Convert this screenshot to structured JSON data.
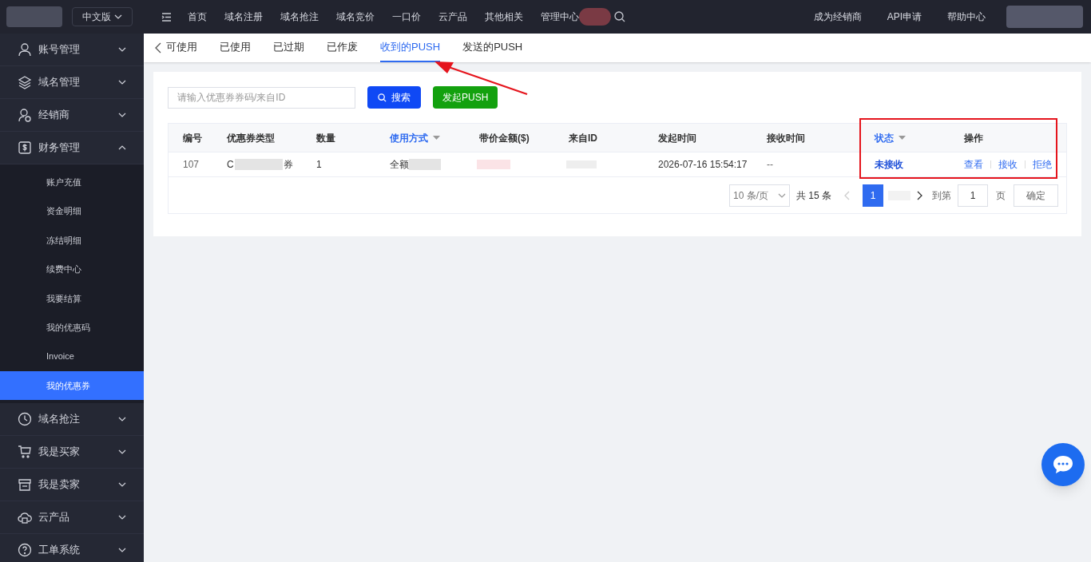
{
  "header": {
    "language": "中文版",
    "nav": [
      "首页",
      "域名注册",
      "域名抢注",
      "域名竞价",
      "一口价",
      "云产品",
      "其他相关",
      "管理中心"
    ],
    "right_links": [
      "成为经销商",
      "API申请",
      "帮助中心"
    ]
  },
  "sidebar": {
    "items": [
      {
        "label": "账号管理",
        "expanded": false
      },
      {
        "label": "域名管理",
        "expanded": false
      },
      {
        "label": "经销商",
        "expanded": false
      },
      {
        "label": "财务管理",
        "expanded": true,
        "children": [
          {
            "label": "账户充值",
            "selected": false
          },
          {
            "label": "资金明细",
            "selected": false
          },
          {
            "label": "冻结明细",
            "selected": false
          },
          {
            "label": "续费中心",
            "selected": false
          },
          {
            "label": "我要结算",
            "selected": false
          },
          {
            "label": "我的优惠码",
            "selected": false
          },
          {
            "label": "Invoice",
            "selected": false
          },
          {
            "label": "我的优惠券",
            "selected": true
          }
        ]
      },
      {
        "label": "域名抢注",
        "expanded": false
      },
      {
        "label": "我是买家",
        "expanded": false
      },
      {
        "label": "我是卖家",
        "expanded": false
      },
      {
        "label": "云产品",
        "expanded": false
      },
      {
        "label": "工单系统",
        "expanded": false
      }
    ]
  },
  "tabs": [
    {
      "label": "可使用",
      "selected": false
    },
    {
      "label": "已使用",
      "selected": false
    },
    {
      "label": "已过期",
      "selected": false
    },
    {
      "label": "已作废",
      "selected": false
    },
    {
      "label": "收到的PUSH",
      "selected": true
    },
    {
      "label": "发送的PUSH",
      "selected": false
    }
  ],
  "search": {
    "placeholder": "请输入优惠券券码/来自ID",
    "button": "搜索",
    "push_button": "发起PUSH"
  },
  "table": {
    "columns": [
      {
        "label": "编号",
        "sortable": false
      },
      {
        "label": "优惠券类型",
        "sortable": false
      },
      {
        "label": "数量",
        "sortable": false
      },
      {
        "label": "使用方式",
        "sortable": true
      },
      {
        "label": "带价金额($)",
        "sortable": false
      },
      {
        "label": "来自ID",
        "sortable": false
      },
      {
        "label": "发起时间",
        "sortable": false
      },
      {
        "label": "接收时间",
        "sortable": false
      },
      {
        "label": "状态",
        "sortable": true
      },
      {
        "label": "操作",
        "sortable": false
      }
    ],
    "rows": [
      {
        "id": "107",
        "type_start": "C",
        "type_end": "券",
        "quantity": "1",
        "usage": "全额",
        "start_time": "2026-07-16 15:54:17",
        "receive_time": "--",
        "status": "未接收",
        "actions": [
          "查看",
          "接收",
          "拒绝"
        ]
      }
    ]
  },
  "pagination": {
    "page_size": "10 条/页",
    "total": "共 15 条",
    "pages": [
      {
        "label": "1",
        "selected": true
      }
    ],
    "goto_label": "到第",
    "goto_value": "1",
    "page_unit": "页",
    "confirm": "确定"
  }
}
